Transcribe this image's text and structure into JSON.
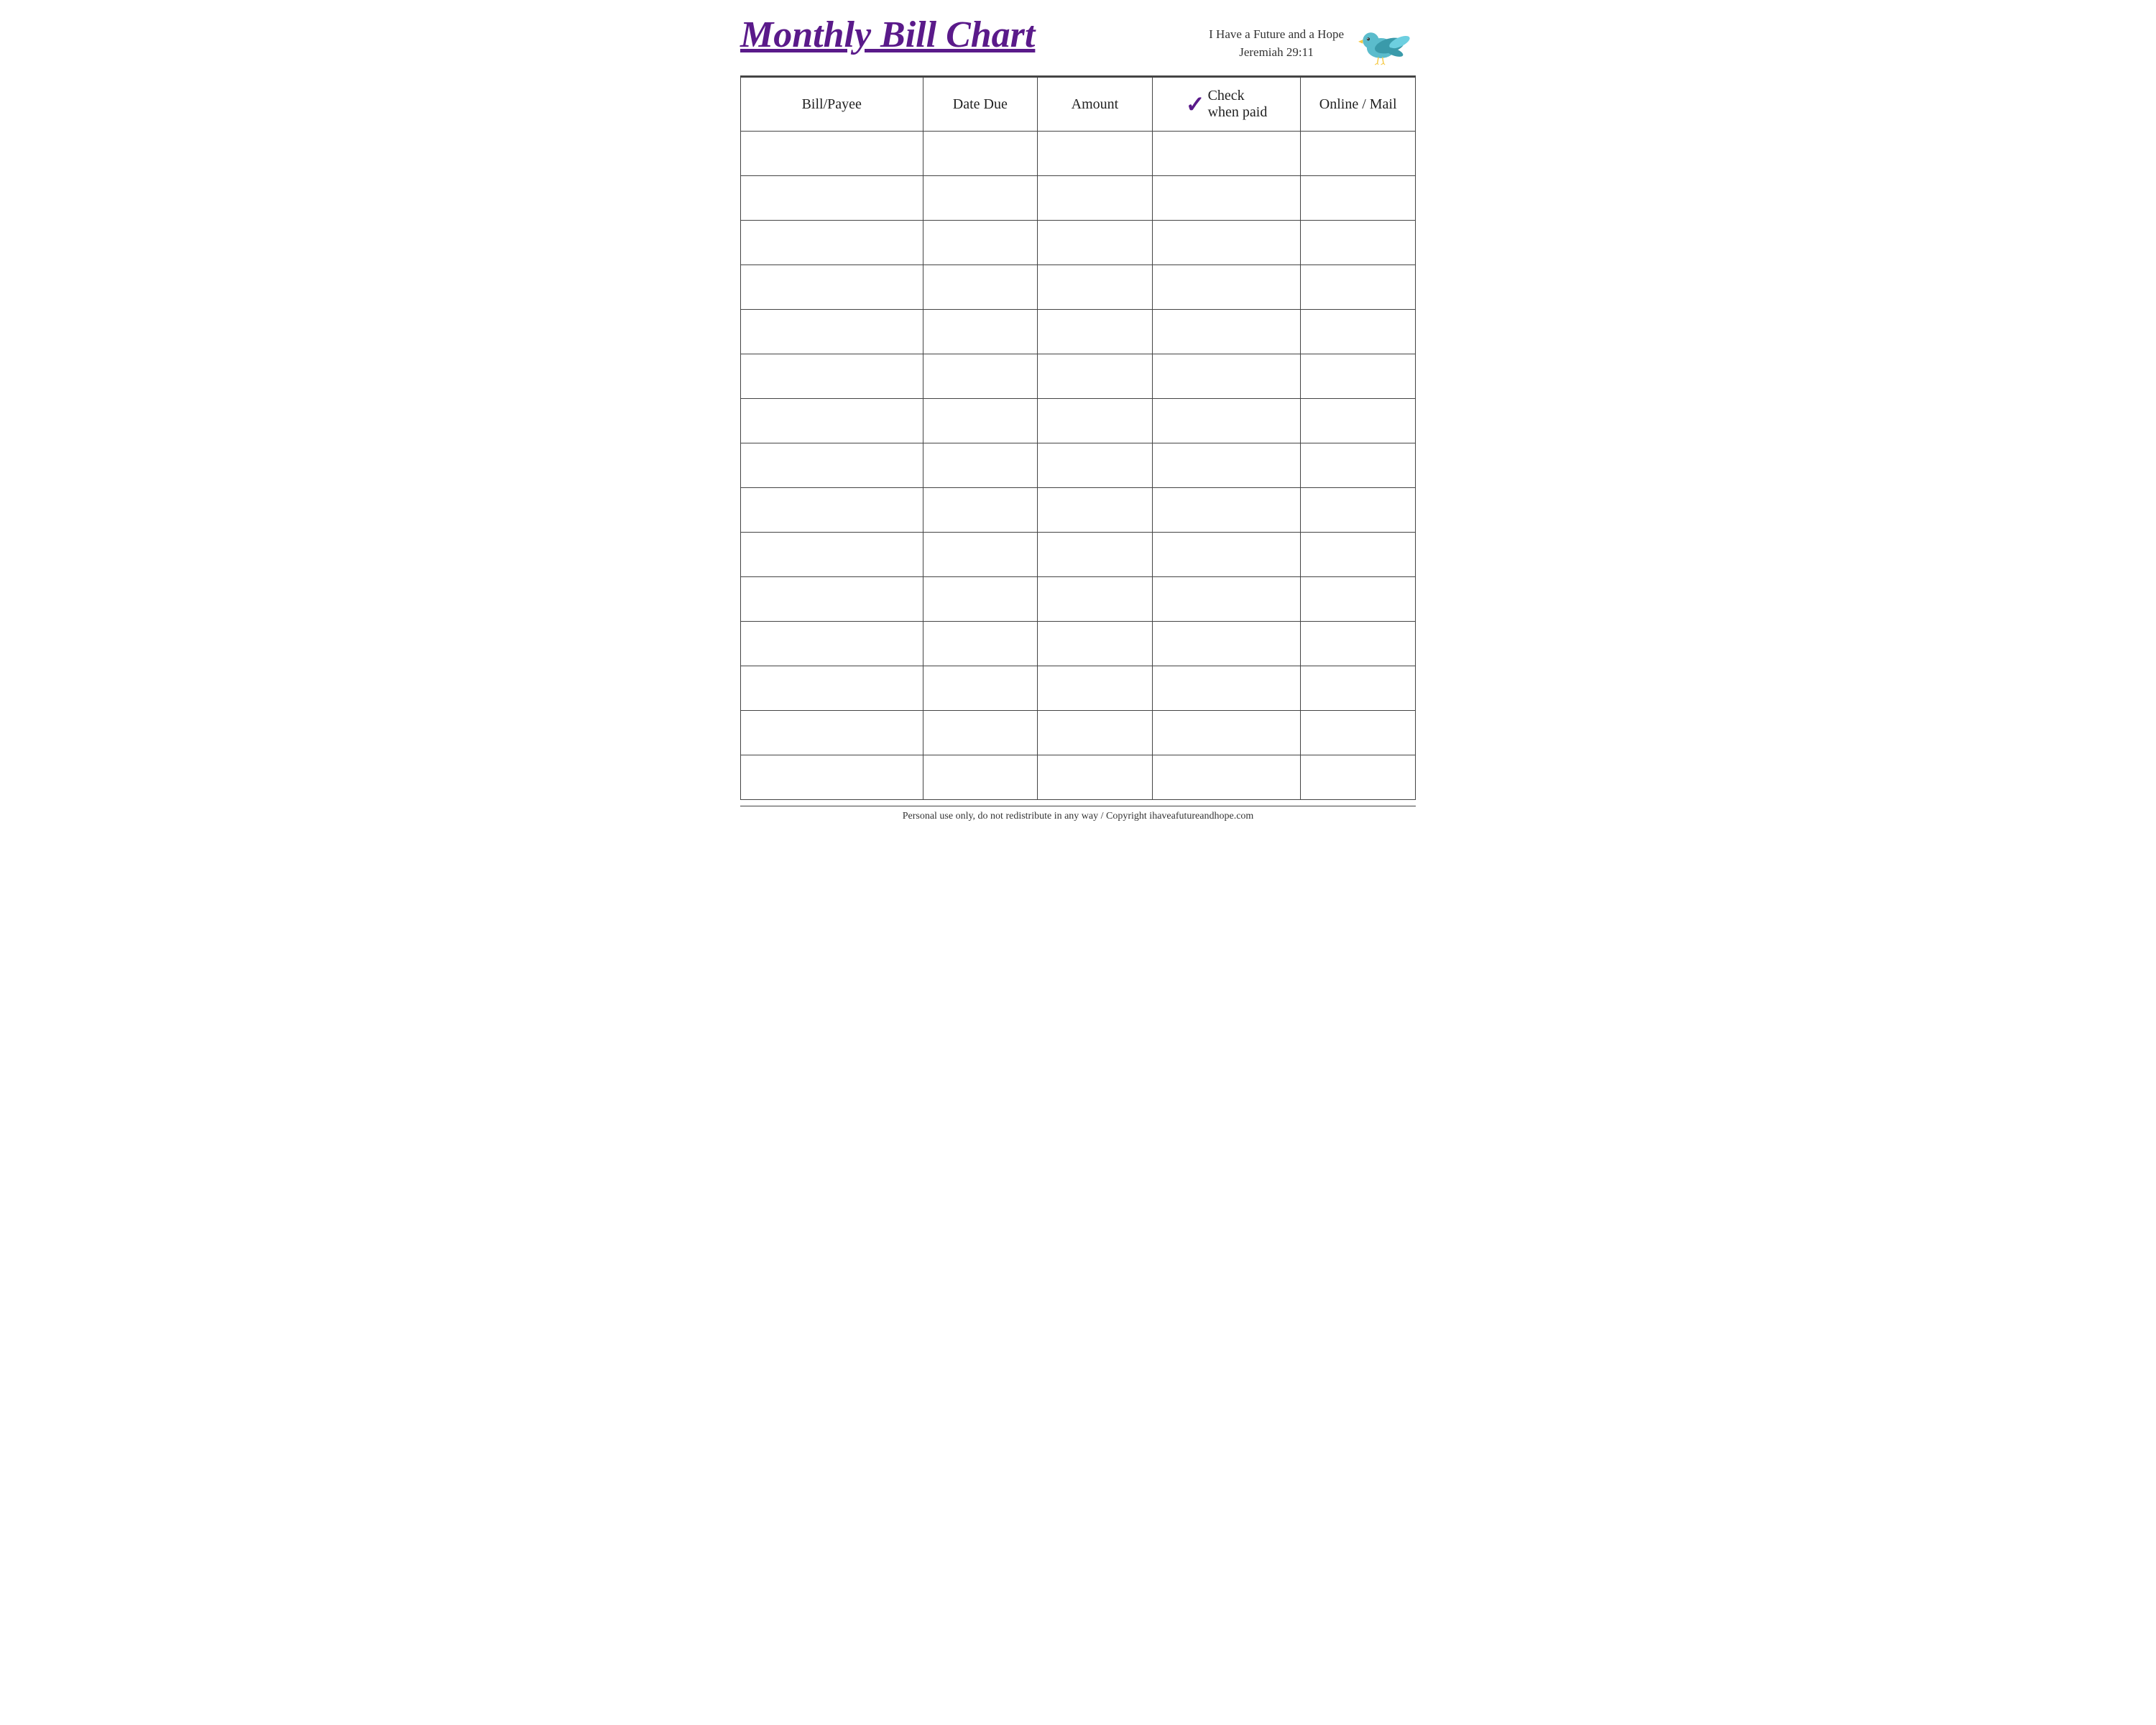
{
  "header": {
    "title": "Monthly Bill Chart",
    "tagline_line1": "I Have a Future and a Hope",
    "tagline_line2": "Jeremiah 29:11"
  },
  "table": {
    "columns": [
      {
        "id": "bill",
        "label": "Bill/Payee"
      },
      {
        "id": "date",
        "label": "Date Due"
      },
      {
        "id": "amount",
        "label": "Amount"
      },
      {
        "id": "check",
        "label_line1": "Check",
        "label_line2": "when paid"
      },
      {
        "id": "online",
        "label": "Online / Mail"
      }
    ],
    "row_count": 15
  },
  "footer": {
    "text": "Personal use only, do not redistribute in any way / Copyright ihaveafutureandhope.com"
  }
}
